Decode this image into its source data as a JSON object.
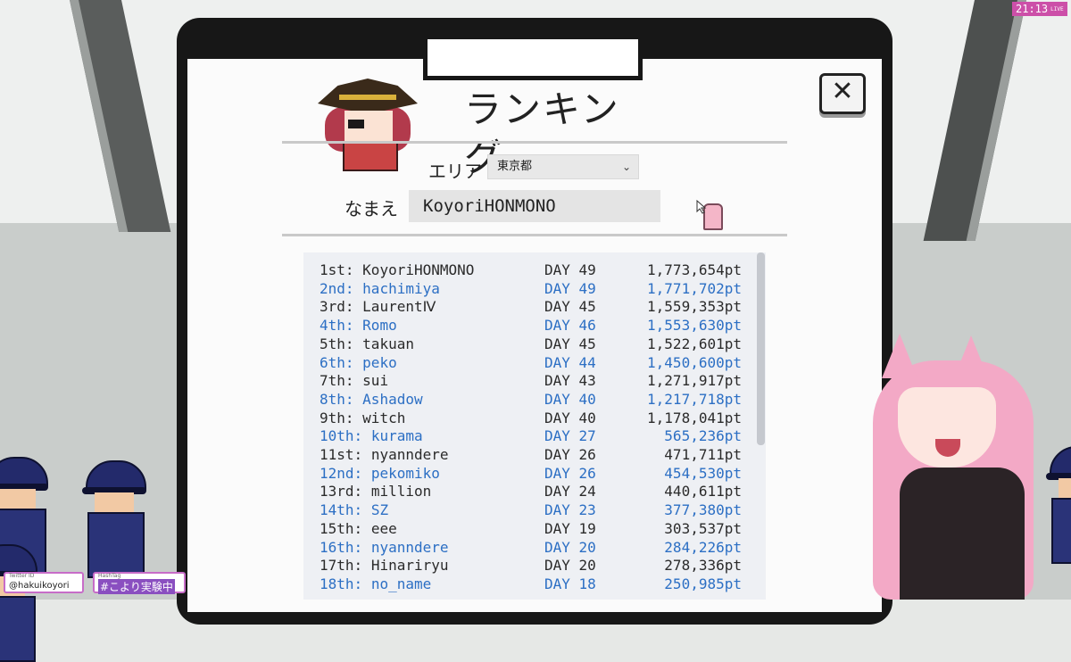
{
  "overlay": {
    "clock": "21:13",
    "clock_live": "LIVE",
    "twitter_caption": "Twitter ID",
    "twitter_handle": "@hakuikoyori",
    "hashtag_caption": "HashTag",
    "hashtag": "#こより実験中"
  },
  "panel": {
    "title": "ランキング",
    "close_label": "✕",
    "area_label": "エリア",
    "area_value": "東京都",
    "name_label": "なまえ",
    "name_value": "KoyoriHONMONO"
  },
  "ranking": {
    "rows": [
      {
        "rank": "1st:",
        "name": "KoyoriHONMONO",
        "day": "DAY 49",
        "points": "1,773,654pt"
      },
      {
        "rank": "2nd:",
        "name": "hachimiya",
        "day": "DAY 49",
        "points": "1,771,702pt"
      },
      {
        "rank": "3rd:",
        "name": "LaurentⅣ",
        "day": "DAY 45",
        "points": "1,559,353pt"
      },
      {
        "rank": "4th:",
        "name": "Romo",
        "day": "DAY 46",
        "points": "1,553,630pt"
      },
      {
        "rank": "5th:",
        "name": "takuan",
        "day": "DAY 45",
        "points": "1,522,601pt"
      },
      {
        "rank": "6th:",
        "name": "peko",
        "day": "DAY 44",
        "points": "1,450,600pt"
      },
      {
        "rank": "7th:",
        "name": "sui",
        "day": "DAY 43",
        "points": "1,271,917pt"
      },
      {
        "rank": "8th:",
        "name": "Ashadow",
        "day": "DAY 40",
        "points": "1,217,718pt"
      },
      {
        "rank": "9th:",
        "name": "witch",
        "day": "DAY 40",
        "points": "1,178,041pt"
      },
      {
        "rank": "10th:",
        "name": "kurama",
        "day": "DAY 27",
        "points": "565,236pt"
      },
      {
        "rank": "11st:",
        "name": "nyanndere",
        "day": "DAY 26",
        "points": "471,711pt"
      },
      {
        "rank": "12nd:",
        "name": "pekomiko",
        "day": "DAY 26",
        "points": "454,530pt"
      },
      {
        "rank": "13rd:",
        "name": "million",
        "day": "DAY 24",
        "points": "440,611pt"
      },
      {
        "rank": "14th:",
        "name": "SZ",
        "day": "DAY 23",
        "points": "377,380pt"
      },
      {
        "rank": "15th:",
        "name": "eee",
        "day": "DAY 19",
        "points": "303,537pt"
      },
      {
        "rank": "16th:",
        "name": "nyanndere",
        "day": "DAY 20",
        "points": "284,226pt"
      },
      {
        "rank": "17th:",
        "name": "Hinariryu",
        "day": "DAY 20",
        "points": "278,336pt"
      },
      {
        "rank": "18th:",
        "name": "no_name",
        "day": "DAY 18",
        "points": "250,985pt"
      }
    ]
  },
  "colors": {
    "odd_row": "#2b2b2b",
    "even_row": "#2c6fc4",
    "accent_overlay": "#cc4fa8"
  }
}
